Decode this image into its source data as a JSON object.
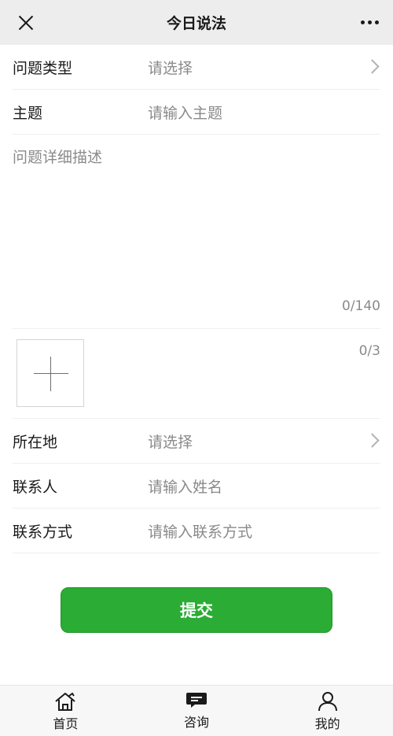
{
  "header": {
    "title": "今日说法",
    "close_icon": "close-icon",
    "more_icon": "more-icon"
  },
  "form": {
    "type_row": {
      "label": "问题类型",
      "value": "请选择"
    },
    "subject_row": {
      "label": "主题",
      "placeholder": "请输入主题"
    },
    "detail": {
      "placeholder": "问题详细描述",
      "counter": "0/140"
    },
    "upload": {
      "counter": "0/3"
    },
    "location_row": {
      "label": "所在地",
      "value": "请选择"
    },
    "contact_name_row": {
      "label": "联系人",
      "placeholder": "请输入姓名"
    },
    "contact_method_row": {
      "label": "联系方式",
      "placeholder": "请输入联系方式"
    }
  },
  "submit": {
    "label": "提交"
  },
  "tabbar": {
    "items": [
      {
        "label": "首页",
        "icon": "home-icon"
      },
      {
        "label": "咨询",
        "icon": "chat-icon"
      },
      {
        "label": "我的",
        "icon": "user-icon"
      }
    ]
  },
  "colors": {
    "accent": "#2aac35",
    "header_bg": "#ededed",
    "placeholder": "#8a8a8a"
  }
}
